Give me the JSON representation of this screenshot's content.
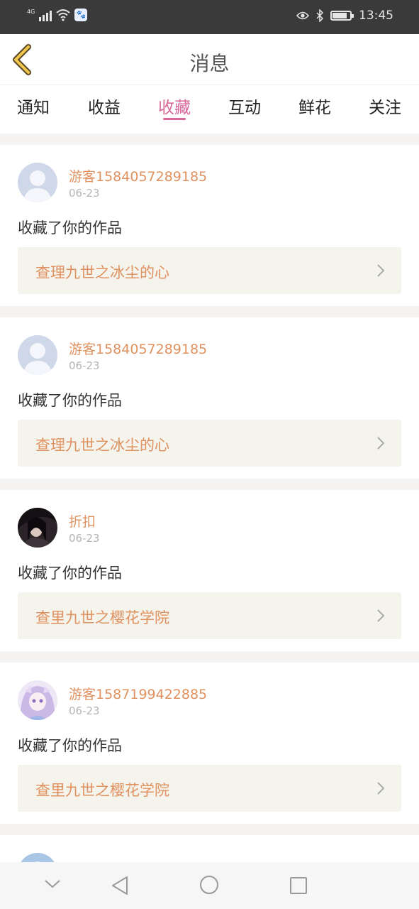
{
  "status_bar": {
    "network": "4G",
    "time": "13:45",
    "battery_level": 0.85,
    "icons": [
      "signal-icon",
      "wifi-icon",
      "baidu-app-icon",
      "eye-icon",
      "bluetooth-icon",
      "battery-icon"
    ]
  },
  "header": {
    "title": "消息",
    "back_icon": "chevron-left-icon"
  },
  "tabs": [
    {
      "label": "通知",
      "active": false
    },
    {
      "label": "收益",
      "active": false
    },
    {
      "label": "收藏",
      "active": true
    },
    {
      "label": "互动",
      "active": false
    },
    {
      "label": "鲜花",
      "active": false
    },
    {
      "label": "关注",
      "active": false
    }
  ],
  "messages": [
    {
      "username": "游客1584057289185",
      "date": "06-23",
      "action": "收藏了你的作品",
      "work_title": "查理九世之冰尘的心",
      "avatar": "default-avatar"
    },
    {
      "username": "游客1584057289185",
      "date": "06-23",
      "action": "收藏了你的作品",
      "work_title": "查理九世之冰尘的心",
      "avatar": "default-avatar"
    },
    {
      "username": "折扣",
      "date": "06-23",
      "action": "收藏了你的作品",
      "work_title": "查里九世之樱花学院",
      "avatar": "dark-photo-avatar"
    },
    {
      "username": "游客1587199422885",
      "date": "06-23",
      "action": "收藏了你的作品",
      "work_title": "查里九世之樱花学院",
      "avatar": "anime-avatar"
    }
  ],
  "nav_bar": {
    "icons": [
      "collapse-icon",
      "back-triangle-icon",
      "home-circle-icon",
      "recents-square-icon"
    ]
  },
  "colors": {
    "accent_pink": "#d9679a",
    "username_orange": "#e09160",
    "work_bg": "#f4f3ec",
    "status_bar_bg": "#3a3a3a"
  }
}
